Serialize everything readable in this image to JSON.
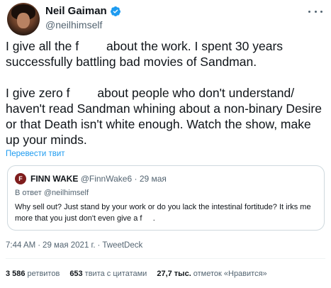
{
  "author": {
    "name": "Neil Gaiman",
    "handle": "@neilhimself",
    "avatar_icon": "profile-photo",
    "verified_icon": "verified-badge-icon",
    "verified_color": "#1d9bf0"
  },
  "more_icon": "more-options-icon",
  "tweet": {
    "paragraph1": "I give all the f        about the work. I spent 30 years successfully battling bad movies of Sandman.",
    "paragraph2": "I give zero f        about people who don't understand/ haven't read Sandman whining about a non-binary Desire or that Death isn't white enough. Watch the show, make up your minds.",
    "translate": "Перевести твит"
  },
  "quote": {
    "avatar_letter": "F",
    "name": "FINN WAKE",
    "handle": "@FinnWake6",
    "dot": "·",
    "date": "29 мая",
    "reply_prefix": "В ответ",
    "reply_handle": "@neilhimself",
    "text": "Why sell out? Just stand by your work or do you lack the intestinal fortitude? It irks me more that you just don't even give a f     ."
  },
  "meta": {
    "time": "7:44 AM",
    "date": "29 мая 2021 г.",
    "source": "TweetDeck",
    "sep": "·"
  },
  "stats": {
    "retweets_count": "3 586",
    "retweets_label": "ретвитов",
    "quotes_count": "653",
    "quotes_label": "твита с цитатами",
    "likes_count": "27,7 тыс.",
    "likes_label": "отметок «Нравится»"
  },
  "colors": {
    "link": "#1d9bf0",
    "secondary_text": "#536471",
    "primary_text": "#0f1419",
    "border": "#cfd9de"
  }
}
